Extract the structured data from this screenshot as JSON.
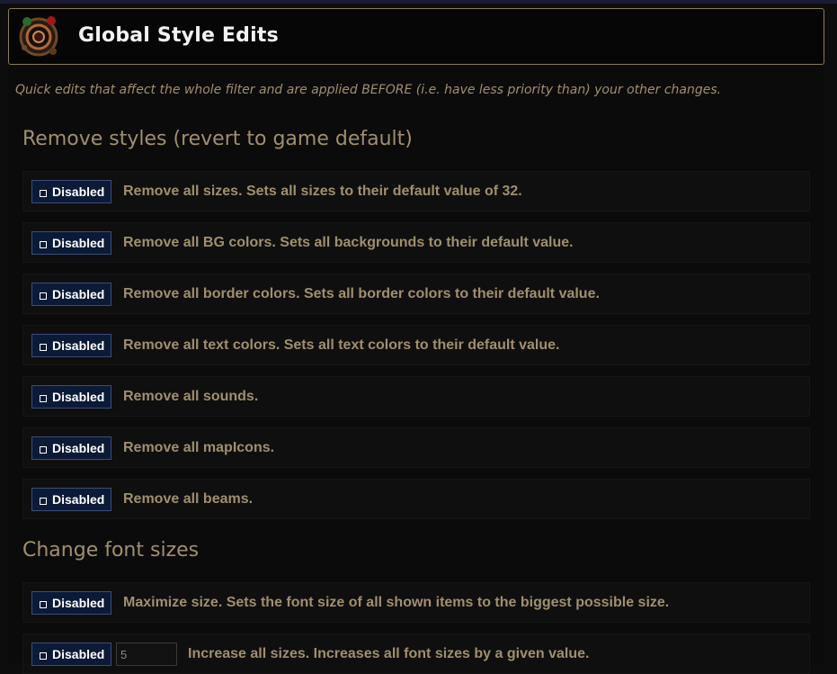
{
  "header": {
    "title": "Global Style Edits"
  },
  "subtitle": "Quick edits that affect the whole filter and are applied BEFORE (i.e. have less priority than) your other changes.",
  "sections": [
    {
      "title": "Remove styles (revert to game default)",
      "rows": [
        {
          "toggle": "Disabled",
          "text": "Remove all sizes.  Sets all sizes to their default value of 32."
        },
        {
          "toggle": "Disabled",
          "text": "Remove all BG colors.  Sets all backgrounds to their default value."
        },
        {
          "toggle": "Disabled",
          "text": "Remove all border colors.  Sets all border colors to their default value."
        },
        {
          "toggle": "Disabled",
          "text": "Remove all text colors.  Sets all text colors to their default value."
        },
        {
          "toggle": "Disabled",
          "text": "Remove all sounds."
        },
        {
          "toggle": "Disabled",
          "text": "Remove all mapIcons."
        },
        {
          "toggle": "Disabled",
          "text": "Remove all beams."
        }
      ]
    },
    {
      "title": "Change font sizes",
      "rows": [
        {
          "toggle": "Disabled",
          "text": "Maximize size.  Sets the font size of all shown items to the biggest possible size."
        },
        {
          "toggle": "Disabled",
          "input_value": "5",
          "text": "Increase all sizes.  Increases all font sizes by a given value."
        }
      ]
    }
  ],
  "colors": {
    "accent_text": "#a08f6e",
    "toggle_bg": "#0b1a36",
    "header_border": "#8a7a5a"
  },
  "icons": {
    "logo": "orb-logo-icon",
    "checkbox": "checkbox-icon"
  }
}
